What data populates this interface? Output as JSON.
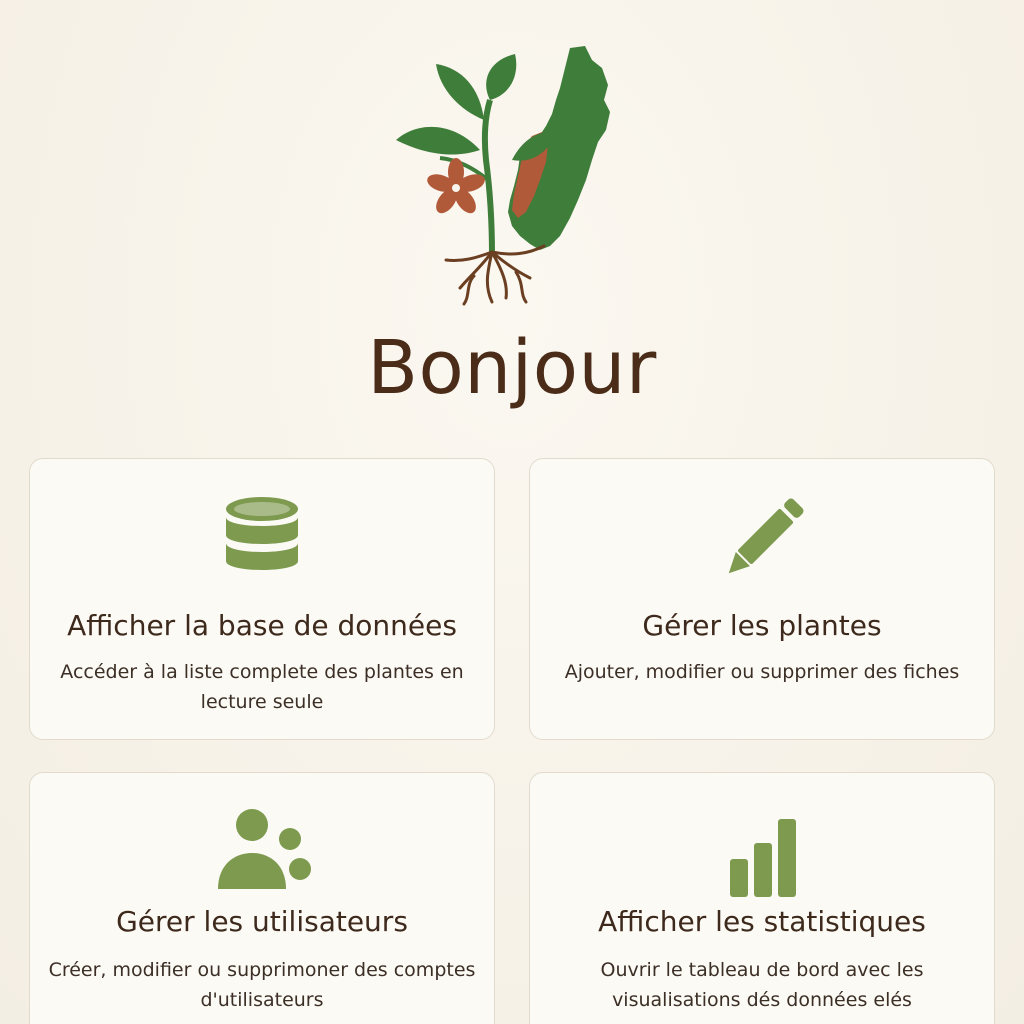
{
  "header": {
    "greeting": "Bonjour"
  },
  "theme": {
    "accent_green": "#7d9a4f",
    "leaf_green": "#3f7d3a",
    "terracotta": "#b15a3a",
    "brown_text": "#4a2c18"
  },
  "cards": [
    {
      "icon": "database-icon",
      "title": "Afficher la base de données",
      "description": "Accéder à la liste complete des plantes en lecture seule"
    },
    {
      "icon": "pencil-icon",
      "title": "Gérer les plantes",
      "description": "Ajouter, modifier ou supprimer des fiches"
    },
    {
      "icon": "users-icon",
      "title": "Gérer les utilisateurs",
      "description": "Créer, modifier ou supprimoner des comptes d'utilisateurs"
    },
    {
      "icon": "bar-chart-icon",
      "title": "Afficher les statistiques",
      "description": "Ouvrir le tableau de bord avec les visualisations dés données elés"
    }
  ]
}
